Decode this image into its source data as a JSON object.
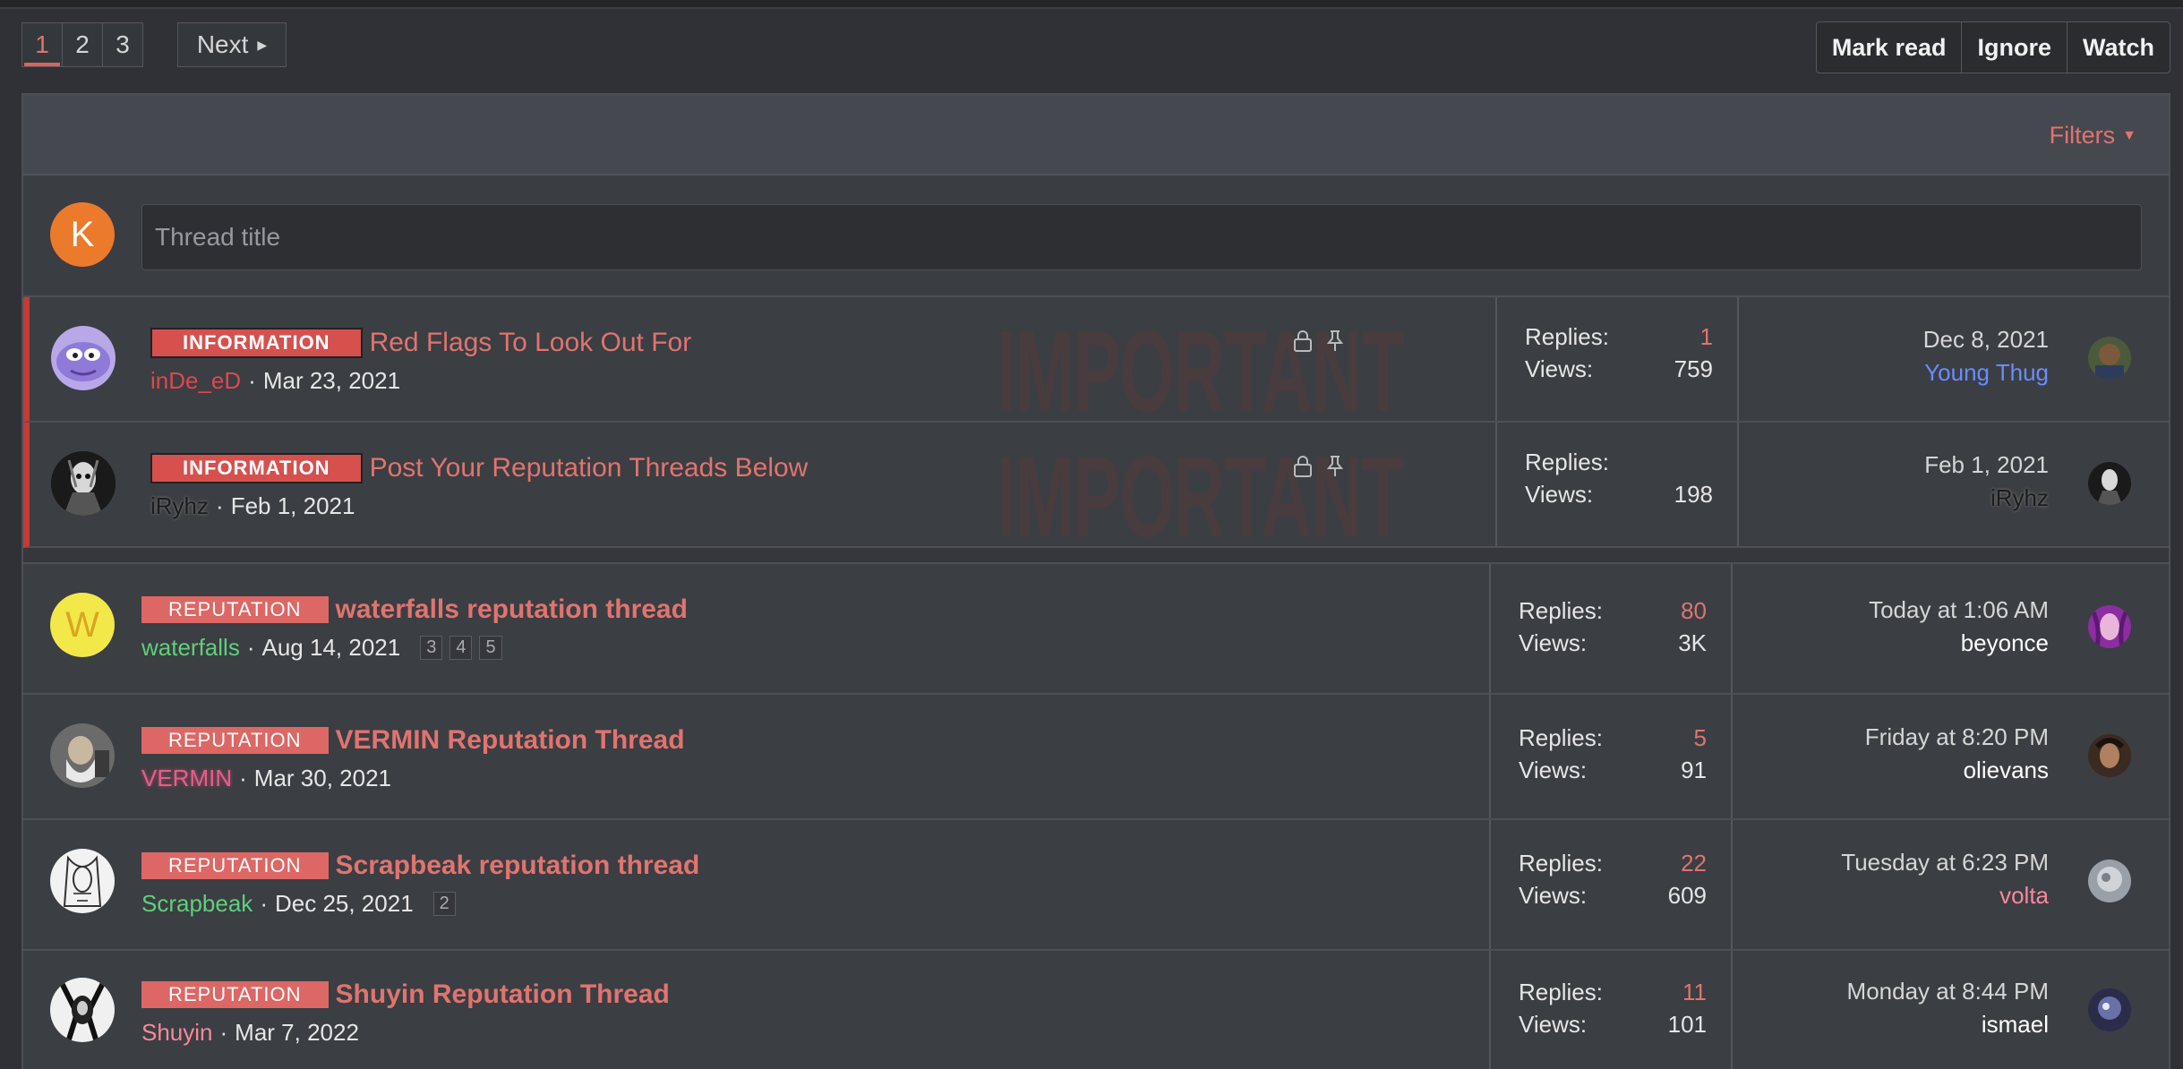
{
  "pagination": {
    "pages": [
      "1",
      "2",
      "3"
    ],
    "next_label": "Next"
  },
  "actions": {
    "mark_read": "Mark read",
    "ignore": "Ignore",
    "watch": "Watch"
  },
  "filters_label": "Filters",
  "new_thread": {
    "avatar_letter": "K",
    "placeholder": "Thread title"
  },
  "sticky_watermark": "IMPORTANT",
  "threads": [
    {
      "prefix": "INFORMATION",
      "title": "Red Flags To Look Out For",
      "author": "inDe_eD",
      "start_date": "Mar 23, 2021",
      "replies_label": "Replies:",
      "replies": "1",
      "views_label": "Views:",
      "views": "759",
      "last_date": "Dec 8, 2021",
      "last_user": "Young Thug"
    },
    {
      "prefix": "INFORMATION",
      "title": "Post Your Reputation Threads Below",
      "author": "iRyhz",
      "start_date": "Feb 1, 2021",
      "replies_label": "Replies:",
      "replies": "",
      "views_label": "Views:",
      "views": "198",
      "last_date": "Feb 1, 2021",
      "last_user": "iRyhz"
    },
    {
      "avatar_letter": "W",
      "prefix": "REPUTATION",
      "title": "waterfalls reputation thread",
      "author": "waterfalls",
      "start_date": "Aug 14, 2021",
      "pages": [
        "3",
        "4",
        "5"
      ],
      "replies_label": "Replies:",
      "replies": "80",
      "views_label": "Views:",
      "views": "3K",
      "last_date": "Today at 1:06 AM",
      "last_user": "beyonce"
    },
    {
      "prefix": "REPUTATION",
      "title": "VERMIN Reputation Thread",
      "author": "VERMIN",
      "start_date": "Mar 30, 2021",
      "replies_label": "Replies:",
      "replies": "5",
      "views_label": "Views:",
      "views": "91",
      "last_date": "Friday at 8:20 PM",
      "last_user": "olievans"
    },
    {
      "prefix": "REPUTATION",
      "title": "Scrapbeak reputation thread",
      "author": "Scrapbeak",
      "start_date": "Dec 25, 2021",
      "pages": [
        "2"
      ],
      "replies_label": "Replies:",
      "replies": "22",
      "views_label": "Views:",
      "views": "609",
      "last_date": "Tuesday at 6:23 PM",
      "last_user": "volta"
    },
    {
      "prefix": "REPUTATION",
      "title": "Shuyin Reputation Thread",
      "author": "Shuyin",
      "start_date": "Mar 7, 2022",
      "replies_label": "Replies:",
      "replies": "11",
      "views_label": "Views:",
      "views": "101",
      "last_date": "Monday at 8:44 PM",
      "last_user": "ismael"
    }
  ],
  "colors": {
    "accent": "#e0746f",
    "sticky_bar": "#c43a36",
    "author_red": "#e0474b",
    "author_green": "#5fd07a",
    "author_pink": "#f58a9a",
    "last_user_blue": "#6a8cff"
  }
}
